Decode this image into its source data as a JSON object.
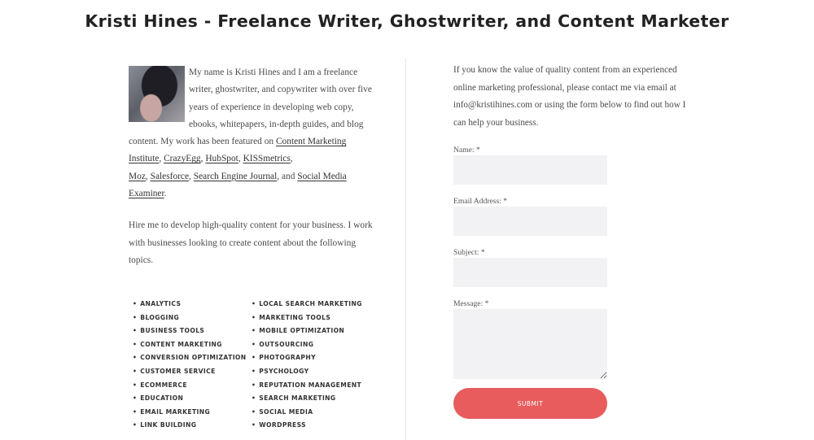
{
  "header": {
    "title": "Kristi Hines - Freelance Writer, Ghostwriter, and Content Marketer"
  },
  "about": {
    "intro": "My name is Kristi Hines and I am a freelance writer, ghostwriter, and copywriter with over five years of experience in developing web copy, ebooks, whitepapers, in-depth guides, and blog content. My work has been featured on",
    "links": [
      "Content Marketing Institute",
      "CrazyEgg",
      "HubSpot",
      "KISSmetrics",
      "Moz",
      "Salesforce",
      "Search Engine Journal",
      "Social Media Examiner"
    ],
    "sep_comma": ",",
    "sep_and": ", and",
    "end": ".",
    "hire": "Hire me to develop high-quality content for your business. I work with businesses looking to create content about the following topics."
  },
  "topics": {
    "col1": [
      "ANALYTICS",
      "BLOGGING",
      "BUSINESS TOOLS",
      "CONTENT MARKETING",
      "CONVERSION OPTIMIZATION",
      "CUSTOMER SERVICE",
      "ECOMMERCE",
      "EDUCATION",
      "EMAIL MARKETING",
      "LINK BUILDING"
    ],
    "col2": [
      "LOCAL SEARCH MARKETING",
      "MARKETING TOOLS",
      "MOBILE OPTIMIZATION",
      "OUTSOURCING",
      "PHOTOGRAPHY",
      "PSYCHOLOGY",
      "REPUTATION MANAGEMENT",
      "SEARCH MARKETING",
      "SOCIAL MEDIA",
      "WORDPRESS"
    ]
  },
  "contact": {
    "text": "If you know the value of quality content from an experienced online marketing professional, please contact me via email at info@kristihines.com or using the form below to find out how I can help your business.",
    "form": {
      "name_label": "Name: *",
      "email_label": "Email Address: *",
      "subject_label": "Subject: *",
      "message_label": "Message: *",
      "submit_label": "SUBMIT"
    }
  }
}
